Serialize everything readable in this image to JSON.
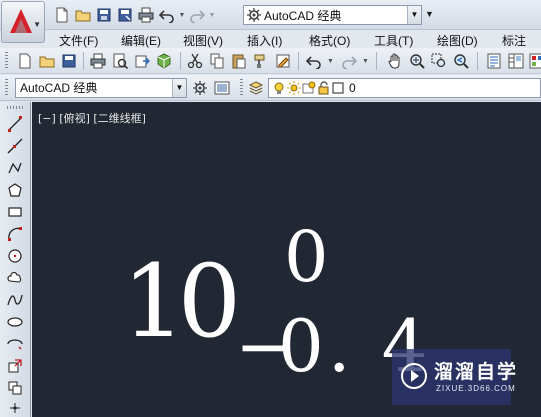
{
  "title_bar": {
    "workspace": "AutoCAD 经典"
  },
  "menu": {
    "items": [
      "文件(F)",
      "编辑(E)",
      "视图(V)",
      "插入(I)",
      "格式(O)",
      "工具(T)",
      "绘图(D)",
      "标注"
    ]
  },
  "styles_toolbar": {
    "workspace_combo": "AutoCAD 经典"
  },
  "layers_toolbar": {
    "current_layer": "0"
  },
  "viewport": {
    "label": "[−] [俯视] [二维线框]"
  },
  "drawing": {
    "main_number": "10",
    "upper_tolerance": "0",
    "lower_tolerance_minus": "−",
    "lower_tolerance_value": "0. 4"
  },
  "watermark": {
    "title": "溜溜自学",
    "url": "ZIXUE.3D66.COM"
  },
  "colors": {
    "canvas": "#212833",
    "autocad_red": "#d4212b",
    "watermark_bg": "#2a3470"
  }
}
